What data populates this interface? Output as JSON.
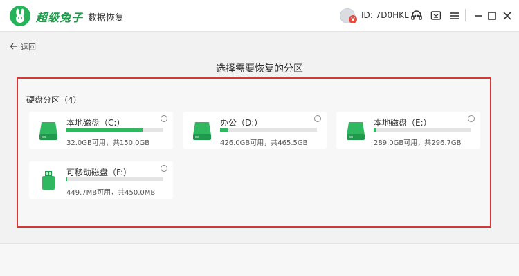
{
  "app": {
    "name": "超级兔子",
    "subtitle": "数据恢复",
    "user_id": "ID: 7D0HKL",
    "avatar_badge": "V",
    "accent_color": "#2fb85f",
    "highlight_color": "#d93636"
  },
  "nav": {
    "back_label": "返回"
  },
  "page": {
    "title": "选择需要恢复的分区"
  },
  "section": {
    "label": "硬盘分区（4）"
  },
  "partitions": [
    {
      "name": "本地磁盘（C:）",
      "info": "32.0GB可用，共150.0GB",
      "used_fraction": 0.787,
      "icon": "hard-drive-icon"
    },
    {
      "name": "办公（D:）",
      "info": "426.0GB可用，共465.5GB",
      "used_fraction": 0.085,
      "icon": "hard-drive-icon"
    },
    {
      "name": "本地磁盘（E:）",
      "info": "289.0GB可用，共296.7GB",
      "used_fraction": 0.026,
      "icon": "hard-drive-icon"
    },
    {
      "name": "可移动磁盘（F:）",
      "info": "449.7MB可用，共450.0MB",
      "used_fraction": 0.001,
      "icon": "usb-drive-icon"
    }
  ]
}
